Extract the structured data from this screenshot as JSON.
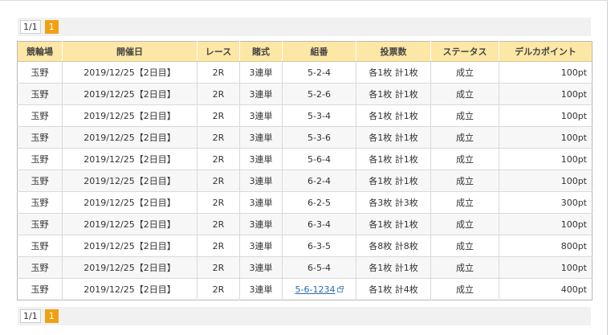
{
  "pager": {
    "count_label": "1/1",
    "current_page": "1"
  },
  "table": {
    "headers": [
      "競輪場",
      "開催日",
      "レース",
      "賭式",
      "組番",
      "投票数",
      "ステータス",
      "デルカポイント"
    ],
    "rows": [
      {
        "venue": "玉野",
        "date": "2019/12/25【2日目】",
        "race": "2R",
        "bet_type": "3連単",
        "combo": "5-2-4",
        "votes": "各1枚 計1枚",
        "status": "成立",
        "points": "100pt"
      },
      {
        "venue": "玉野",
        "date": "2019/12/25【2日目】",
        "race": "2R",
        "bet_type": "3連単",
        "combo": "5-2-6",
        "votes": "各1枚 計1枚",
        "status": "成立",
        "points": "100pt"
      },
      {
        "venue": "玉野",
        "date": "2019/12/25【2日目】",
        "race": "2R",
        "bet_type": "3連単",
        "combo": "5-3-4",
        "votes": "各1枚 計1枚",
        "status": "成立",
        "points": "100pt"
      },
      {
        "venue": "玉野",
        "date": "2019/12/25【2日目】",
        "race": "2R",
        "bet_type": "3連単",
        "combo": "5-3-6",
        "votes": "各1枚 計1枚",
        "status": "成立",
        "points": "100pt"
      },
      {
        "venue": "玉野",
        "date": "2019/12/25【2日目】",
        "race": "2R",
        "bet_type": "3連単",
        "combo": "5-6-4",
        "votes": "各1枚 計1枚",
        "status": "成立",
        "points": "100pt"
      },
      {
        "venue": "玉野",
        "date": "2019/12/25【2日目】",
        "race": "2R",
        "bet_type": "3連単",
        "combo": "6-2-4",
        "votes": "各1枚 計1枚",
        "status": "成立",
        "points": "100pt"
      },
      {
        "venue": "玉野",
        "date": "2019/12/25【2日目】",
        "race": "2R",
        "bet_type": "3連単",
        "combo": "6-2-5",
        "votes": "各3枚 計3枚",
        "status": "成立",
        "points": "300pt"
      },
      {
        "venue": "玉野",
        "date": "2019/12/25【2日目】",
        "race": "2R",
        "bet_type": "3連単",
        "combo": "6-3-4",
        "votes": "各1枚 計1枚",
        "status": "成立",
        "points": "100pt"
      },
      {
        "venue": "玉野",
        "date": "2019/12/25【2日目】",
        "race": "2R",
        "bet_type": "3連単",
        "combo": "6-3-5",
        "votes": "各8枚 計8枚",
        "status": "成立",
        "points": "800pt"
      },
      {
        "venue": "玉野",
        "date": "2019/12/25【2日目】",
        "race": "2R",
        "bet_type": "3連単",
        "combo": "6-5-4",
        "votes": "各1枚 計1枚",
        "status": "成立",
        "points": "100pt"
      },
      {
        "venue": "玉野",
        "date": "2019/12/25【2日目】",
        "race": "2R",
        "bet_type": "3連単",
        "combo": "5-6-1234",
        "combo_is_link": true,
        "votes": "各1枚 計4枚",
        "status": "成立",
        "points": "400pt"
      }
    ]
  },
  "icons": {
    "combo_link_icon": "external-window-icon"
  }
}
